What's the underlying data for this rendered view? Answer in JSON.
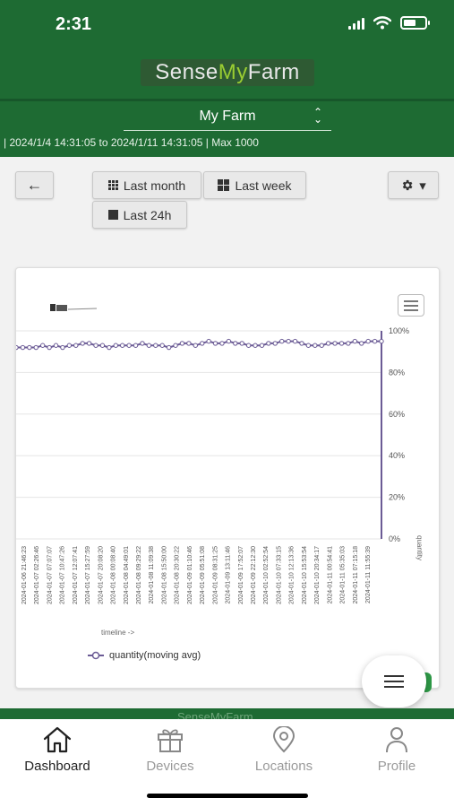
{
  "status_bar": {
    "time": "2:31"
  },
  "brand": {
    "part1": "Sense",
    "part2": "My",
    "part3": "Farm"
  },
  "farm_selector": {
    "value": "My Farm"
  },
  "range_info": "| 2024/1/4 14:31:05 to 2024/1/11 14:31:05 | Max 1000",
  "controls": {
    "back_label": "←",
    "last_month_label": "Last month",
    "last_week_label": "Last week",
    "last_24h_label": "Last 24h",
    "settings_caret": "▾"
  },
  "chart_data": {
    "type": "line",
    "series": [
      {
        "name": "quantity(moving avg)",
        "values": [
          92,
          92,
          92,
          92,
          93,
          92,
          93,
          92,
          93,
          93,
          94,
          94,
          93,
          93,
          92,
          93,
          93,
          93,
          93,
          94,
          93,
          93,
          93,
          92,
          93,
          94,
          94,
          93,
          94,
          95,
          94,
          94,
          95,
          94,
          94,
          93,
          93,
          93,
          94,
          94,
          95,
          95,
          95,
          94,
          93,
          93,
          93,
          94,
          94,
          94,
          94,
          95,
          94,
          95,
          95,
          95
        ]
      }
    ],
    "categories": [
      "2024-01-06 21:46:23",
      "2024-01-07 02:26:46",
      "2024-01-07 07:07:07",
      "2024-01-07 10:47:26",
      "2024-01-07 12:07:41",
      "2024-01-07 15:27:59",
      "2024-01-07 20:08:20",
      "2024-01-08 00:08:40",
      "2024-01-08 04:49:01",
      "2024-01-08 09:29:22",
      "2024-01-08 11:09:38",
      "2024-01-08 15:50:00",
      "2024-01-08 20:30:22",
      "2024-01-09 01:10:46",
      "2024-01-09 05:51:08",
      "2024-01-09 08:31:25",
      "2024-01-09 13:11:46",
      "2024-01-09 17:52:07",
      "2024-01-09 22:12:30",
      "2024-01-10 02:52:54",
      "2024-01-10 07:33:15",
      "2024-01-10 12:13:36",
      "2024-01-10 15:53:54",
      "2024-01-10 20:34:17",
      "2024-01-11 00:54:41",
      "2024-01-11 05:35:03",
      "2024-01-11 07:15:18",
      "2024-01-11 11:55:39"
    ],
    "ylim": [
      0,
      100
    ],
    "yticks": [
      "0%",
      "20%",
      "40%",
      "60%",
      "80%",
      "100%"
    ],
    "xlabel": "timeline ->",
    "ylabel": "quantity",
    "legend": "bottom-left",
    "grid": true,
    "line_color": "#6b5b95"
  },
  "tabs": [
    {
      "label": "Dashboard",
      "icon": "home-icon",
      "active": true
    },
    {
      "label": "Devices",
      "icon": "gift-icon",
      "active": false
    },
    {
      "label": "Locations",
      "icon": "location-pin-icon",
      "active": false
    },
    {
      "label": "Profile",
      "icon": "person-icon",
      "active": false
    }
  ],
  "footer": {
    "text": "SenseMyFarm"
  },
  "colors": {
    "header_green": "#1e6b33",
    "accent_lime": "#9acd32",
    "series_purple": "#6b5b95"
  }
}
